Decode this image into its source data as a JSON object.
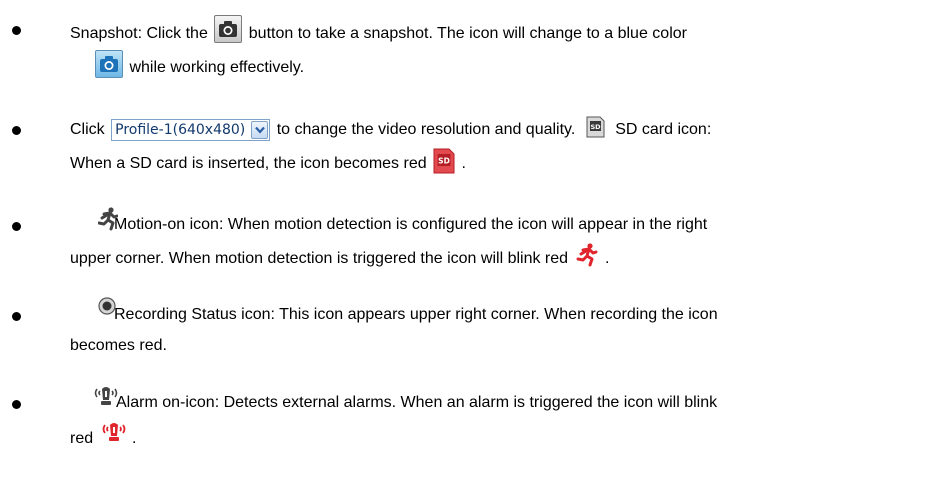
{
  "items": [
    {
      "line1_a": "Snapshot: Click the",
      "line1_b": "button to take a snapshot. The icon will change to a blue color",
      "line2": "while working effectively."
    },
    {
      "line1_a": "Click",
      "dropdown_value": "Profile-1(640x480)",
      "line1_b": "to change the video resolution and quality.",
      "line1_c": "SD card icon:",
      "line2": "When a SD card is inserted, the icon becomes red",
      "line2_end": "."
    },
    {
      "line1": "Motion-on icon: When motion detection is configured the icon will appear in the right",
      "line2": "upper corner. When motion detection is triggered the icon will blink red",
      "line2_end": "."
    },
    {
      "line1": "Recording Status icon: This icon appears upper right corner. When recording the icon",
      "line2": "becomes red."
    },
    {
      "line1": "Alarm on-icon: Detects external alarms. When an alarm is triggered the icon will blink",
      "line2": "red",
      "line2_end": "."
    }
  ],
  "icons": {
    "snapshot_button": "camera-icon",
    "snapshot_button_active": "camera-icon-blue",
    "dropdown_arrow": "chevron-down-icon",
    "sd_card": "sd-card-icon",
    "sd_card_red": "sd-card-icon-red",
    "motion": "running-man-icon",
    "motion_red": "running-man-icon-red",
    "recording": "record-icon",
    "alarm": "alarm-icon",
    "alarm_red": "alarm-icon-red"
  },
  "colors": {
    "active_blue": "#2f93d6",
    "alert_red": "#e0262c",
    "dropdown_text": "#123a6e"
  }
}
